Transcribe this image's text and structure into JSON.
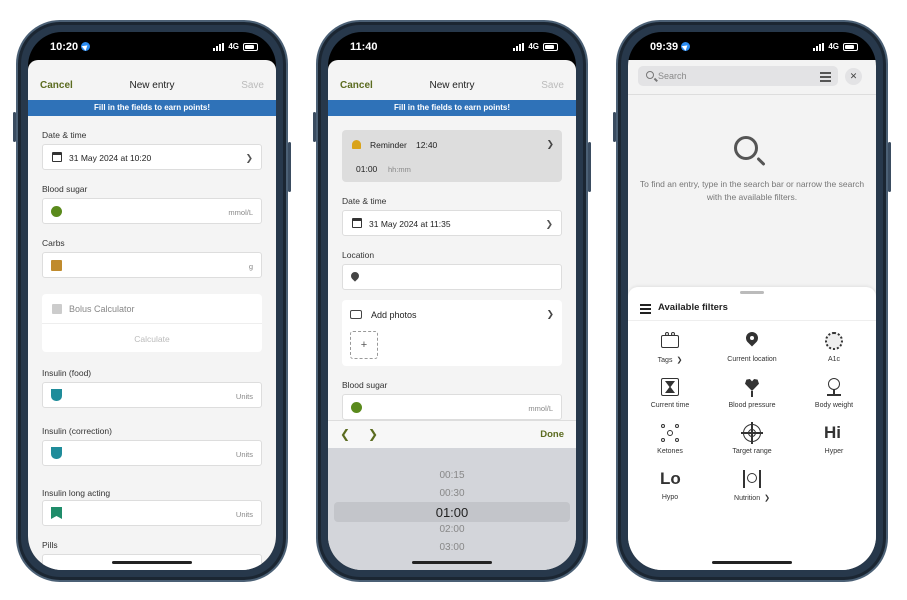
{
  "phone1": {
    "status": {
      "time": "10:20",
      "network": "4G"
    },
    "nav": {
      "cancel": "Cancel",
      "title": "New entry",
      "save": "Save"
    },
    "banner": "Fill in the fields to earn points!",
    "date_label": "Date & time",
    "date_value": "31 May 2024 at 10:20",
    "blood_sugar_label": "Blood sugar",
    "blood_sugar_unit": "mmol/L",
    "carbs_label": "Carbs",
    "carbs_unit": "g",
    "bolus_label": "Bolus Calculator",
    "calculate": "Calculate",
    "insulin_food_label": "Insulin (food)",
    "insulin_correction_label": "Insulin (correction)",
    "insulin_long_label": "Insulin long acting",
    "units": "Units",
    "pills_label": "Pills"
  },
  "phone2": {
    "status": {
      "time": "11:40",
      "network": "4G"
    },
    "nav": {
      "cancel": "Cancel",
      "title": "New entry",
      "save": "Save"
    },
    "banner": "Fill in the fields to earn points!",
    "reminder_label": "Reminder",
    "reminder_time": "12:40",
    "reminder_duration": "01:00",
    "reminder_format": "hh:mm",
    "date_label": "Date & time",
    "date_value": "31 May 2024 at 11:35",
    "location_label": "Location",
    "add_photos": "Add photos",
    "add_photo_plus": "+",
    "blood_sugar_label": "Blood sugar",
    "blood_sugar_unit": "mmol/L",
    "done": "Done",
    "picker_options": [
      "00:15",
      "00:30",
      "01:00",
      "02:00",
      "03:00"
    ],
    "picker_selected_index": 2
  },
  "phone3": {
    "status": {
      "time": "09:39",
      "network": "4G"
    },
    "search_placeholder": "Search",
    "empty_text": "To find an entry, type in the search bar or narrow the search with the available filters.",
    "filters_title": "Available filters",
    "filters": [
      {
        "label": "Tags",
        "has_chevron": true,
        "icon": "tags-icon"
      },
      {
        "label": "Current location",
        "has_chevron": false,
        "icon": "location-pin-icon"
      },
      {
        "label": "A1c",
        "has_chevron": false,
        "icon": "a1c-icon"
      },
      {
        "label": "Current time",
        "has_chevron": false,
        "icon": "hourglass-icon"
      },
      {
        "label": "Blood pressure",
        "has_chevron": false,
        "icon": "heart-icon"
      },
      {
        "label": "Body weight",
        "has_chevron": false,
        "icon": "scale-icon"
      },
      {
        "label": "Ketones",
        "has_chevron": false,
        "icon": "ketones-icon"
      },
      {
        "label": "Target range",
        "has_chevron": false,
        "icon": "target-icon"
      },
      {
        "label": "Hyper",
        "has_chevron": false,
        "icon": "hyper-icon"
      },
      {
        "label": "Hypo",
        "has_chevron": false,
        "icon": "hypo-icon"
      },
      {
        "label": "Nutrition",
        "has_chevron": true,
        "icon": "cutlery-icon"
      }
    ]
  },
  "colors": {
    "accent": "#5b6b1f",
    "banner": "#2f72b8",
    "blood_sugar": "#5a8a1c",
    "carbs": "#c08b2d",
    "insulin": "#1f8c9a"
  }
}
